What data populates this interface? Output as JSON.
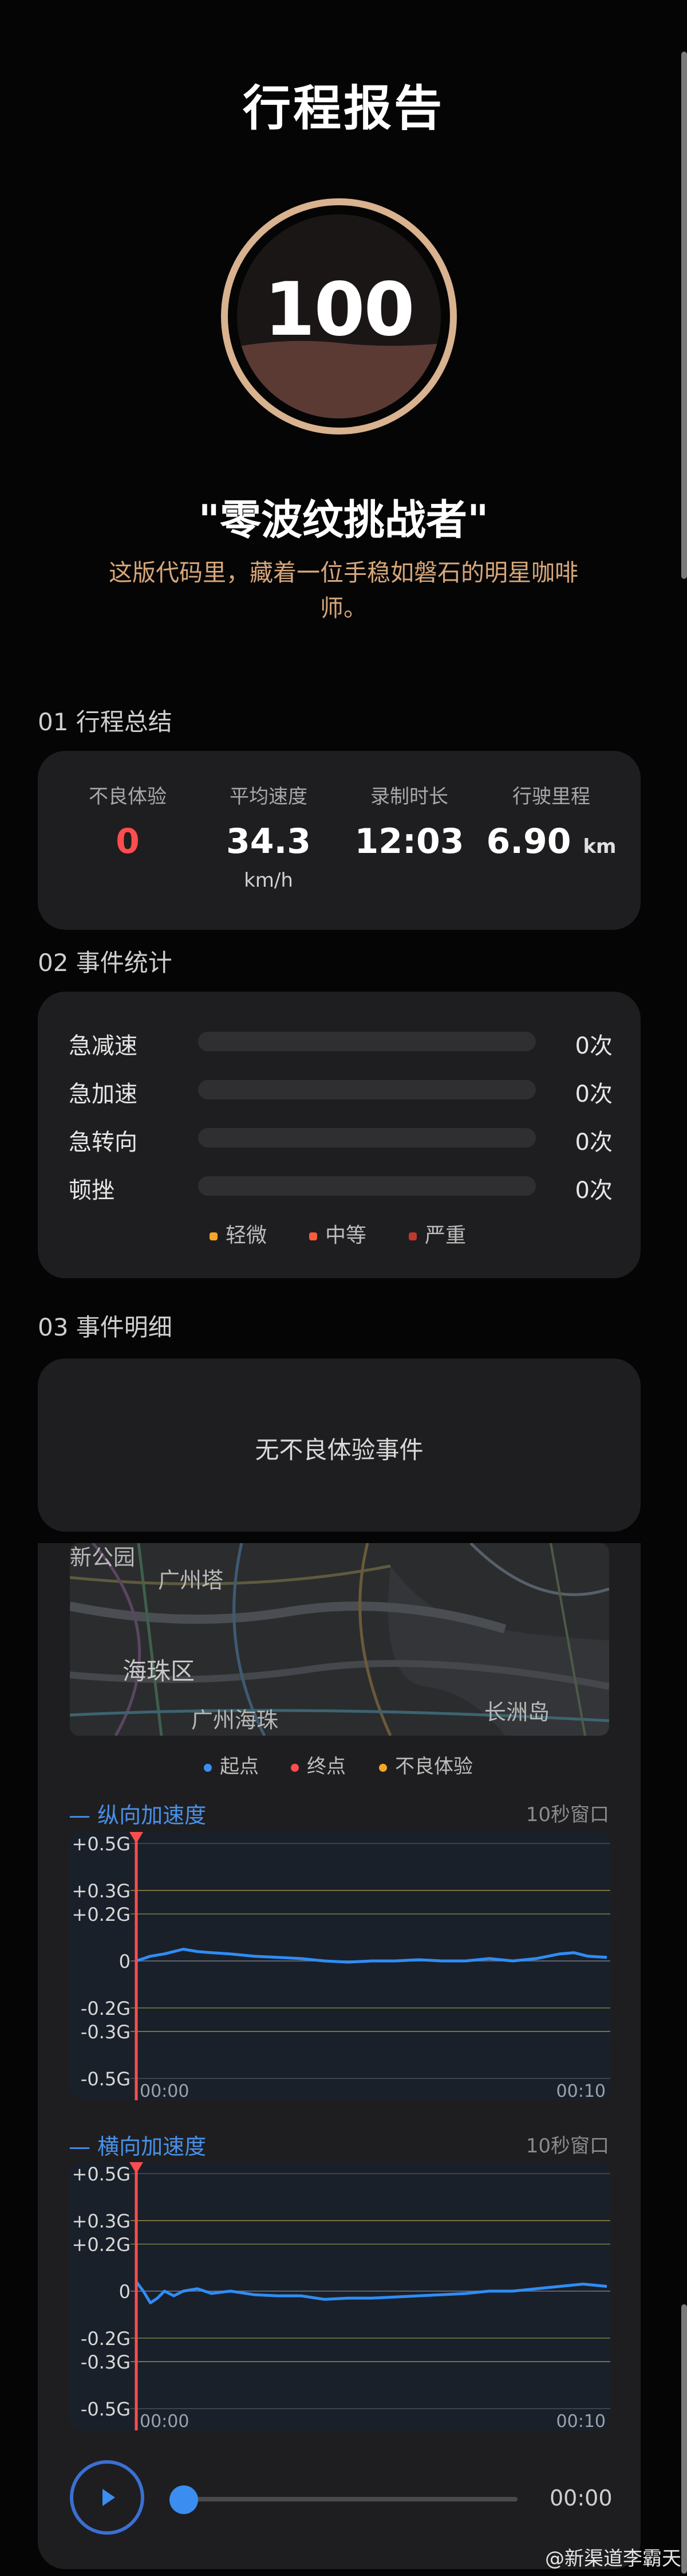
{
  "header": {
    "title": "行程报告",
    "score": "100",
    "score_level": 0.37
  },
  "badge": {
    "title": "\"零波纹挑战者\"",
    "description": "这版代码里，藏着一位手稳如磐石的明星咖啡师。"
  },
  "summary": {
    "section_title": "01 行程总结",
    "stats": [
      {
        "label": "不良体验",
        "value": "0",
        "unit": "",
        "color": "#ff4d4f"
      },
      {
        "label": "平均速度",
        "value": "34.3",
        "unit": "km/h"
      },
      {
        "label": "录制时长",
        "value": "12:03",
        "unit": ""
      },
      {
        "label": "行驶里程",
        "value": "6.90",
        "unit": "km"
      }
    ]
  },
  "events": {
    "section_title": "02 事件统计",
    "rows": [
      {
        "label": "急减速",
        "count": "0次"
      },
      {
        "label": "急加速",
        "count": "0次"
      },
      {
        "label": "急转向",
        "count": "0次"
      },
      {
        "label": "顿挫",
        "count": "0次"
      }
    ],
    "legend": [
      {
        "label": "轻微",
        "color": "#f5a623"
      },
      {
        "label": "中等",
        "color": "#ff5a3c"
      },
      {
        "label": "严重",
        "color": "#c0392b"
      }
    ]
  },
  "details": {
    "section_title": "03 事件明细",
    "empty_text": "无不良体验事件"
  },
  "map": {
    "labels": [
      "新公园",
      "广州塔",
      "海珠区",
      "广州海珠",
      "长洲岛"
    ],
    "legend": [
      {
        "label": "起点",
        "color": "#3b8df0"
      },
      {
        "label": "终点",
        "color": "#ff4d4f"
      },
      {
        "label": "不良体验",
        "color": "#f5a623"
      }
    ]
  },
  "chart_data": [
    {
      "type": "line",
      "title": "— 纵向加速度",
      "window_label": "10秒窗口",
      "yticks": [
        "+0.5G",
        "+0.3G",
        "+0.2G",
        "0",
        "-0.2G",
        "-0.3G",
        "-0.5G"
      ],
      "ytick_values": [
        0.5,
        0.3,
        0.2,
        0,
        -0.2,
        -0.3,
        -0.5
      ],
      "ylim": [
        -0.5,
        0.5
      ],
      "xlim": [
        0,
        10
      ],
      "xtick_labels": [
        "00:00",
        "00:10"
      ],
      "series": [
        {
          "color": "#2f8df5",
          "x": [
            0,
            0.3,
            0.6,
            1.0,
            1.3,
            1.6,
            2.0,
            2.5,
            3.0,
            3.5,
            4.0,
            4.5,
            5.0,
            5.5,
            6.0,
            6.5,
            7.0,
            7.5,
            8.0,
            8.5,
            9.0,
            9.3,
            9.6,
            10.0
          ],
          "y": [
            0.0,
            0.02,
            0.03,
            0.05,
            0.04,
            0.035,
            0.03,
            0.02,
            0.015,
            0.01,
            0.0,
            -0.005,
            0.0,
            0.0,
            0.005,
            0.0,
            0.0,
            0.01,
            0.0,
            0.01,
            0.03,
            0.035,
            0.02,
            0.015
          ]
        }
      ]
    },
    {
      "type": "line",
      "title": "— 横向加速度",
      "window_label": "10秒窗口",
      "yticks": [
        "+0.5G",
        "+0.3G",
        "+0.2G",
        "0",
        "-0.2G",
        "-0.3G",
        "-0.5G"
      ],
      "ytick_values": [
        0.5,
        0.3,
        0.2,
        0,
        -0.2,
        -0.3,
        -0.5
      ],
      "ylim": [
        -0.5,
        0.5
      ],
      "xlim": [
        0,
        10
      ],
      "xtick_labels": [
        "00:00",
        "00:10"
      ],
      "series": [
        {
          "color": "#2f8df5",
          "x": [
            0,
            0.15,
            0.3,
            0.45,
            0.6,
            0.8,
            1.0,
            1.3,
            1.6,
            2.0,
            2.5,
            3.0,
            3.5,
            4.0,
            4.5,
            5.0,
            5.5,
            6.0,
            6.5,
            7.0,
            7.5,
            8.0,
            8.5,
            9.0,
            9.5,
            10.0
          ],
          "y": [
            0.04,
            0.0,
            -0.05,
            -0.03,
            0.0,
            -0.02,
            0.0,
            0.01,
            -0.01,
            0.0,
            -0.015,
            -0.02,
            -0.02,
            -0.035,
            -0.03,
            -0.03,
            -0.025,
            -0.02,
            -0.015,
            -0.01,
            0.0,
            0.0,
            0.01,
            0.02,
            0.03,
            0.02
          ]
        }
      ]
    }
  ],
  "player": {
    "time": "00:00",
    "progress": 0.0
  },
  "watermark": "@新渠道李霸天"
}
